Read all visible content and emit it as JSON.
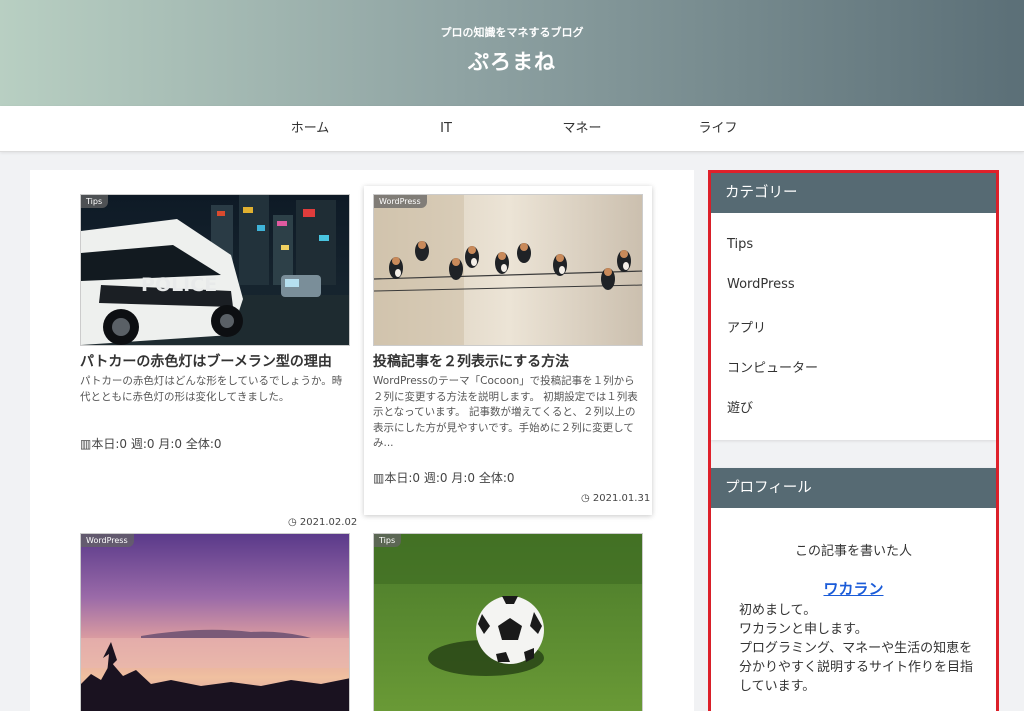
{
  "header": {
    "tagline": "プロの知識をマネするブログ",
    "site_title": "ぷろまね"
  },
  "nav": {
    "items": [
      {
        "label": "ホーム"
      },
      {
        "label": "IT"
      },
      {
        "label": "マネー"
      },
      {
        "label": "ライフ"
      }
    ]
  },
  "posts": [
    {
      "category": "Tips",
      "title": "パトカーの赤色灯はブーメラン型の理由",
      "snippet": "パトカーの赤色灯はどんな形をしているでしょうか。時代とともに赤色灯の形は変化してきました。",
      "stats": "本日:0 週:0 月:0 全体:0",
      "date": "2021.02.02"
    },
    {
      "category": "WordPress",
      "title": "投稿記事を２列表示にする方法",
      "snippet": "WordPressのテーマ「Cocoon」で投稿記事を１列から２列に変更する方法を説明します。 初期設定では１列表示となっています。 記事数が増えてくると、２列以上の表示にした方が見やすいです。手始めに２列に変更してみ...",
      "stats": "本日:0 週:0 月:0 全体:0",
      "date": "2021.01.31"
    },
    {
      "category": "WordPress"
    },
    {
      "category": "Tips"
    }
  ],
  "sidebar": {
    "categories_title": "カテゴリー",
    "categories": [
      "Tips",
      "WordPress",
      "アプリ",
      "コンピューター",
      "遊び"
    ],
    "profile_title": "プロフィール",
    "profile_lead": "この記事を書いた人",
    "profile_name": "ワカラン",
    "profile_bio": "初めまして。\nワカランと申します。\nプログラミング、マネーや生活の知恵を分かりやすく説明するサイト作りを目指しています。"
  },
  "colors": {
    "widget_header": "#566a73",
    "highlight_border": "#e0212b",
    "link": "#1a5bd8"
  }
}
